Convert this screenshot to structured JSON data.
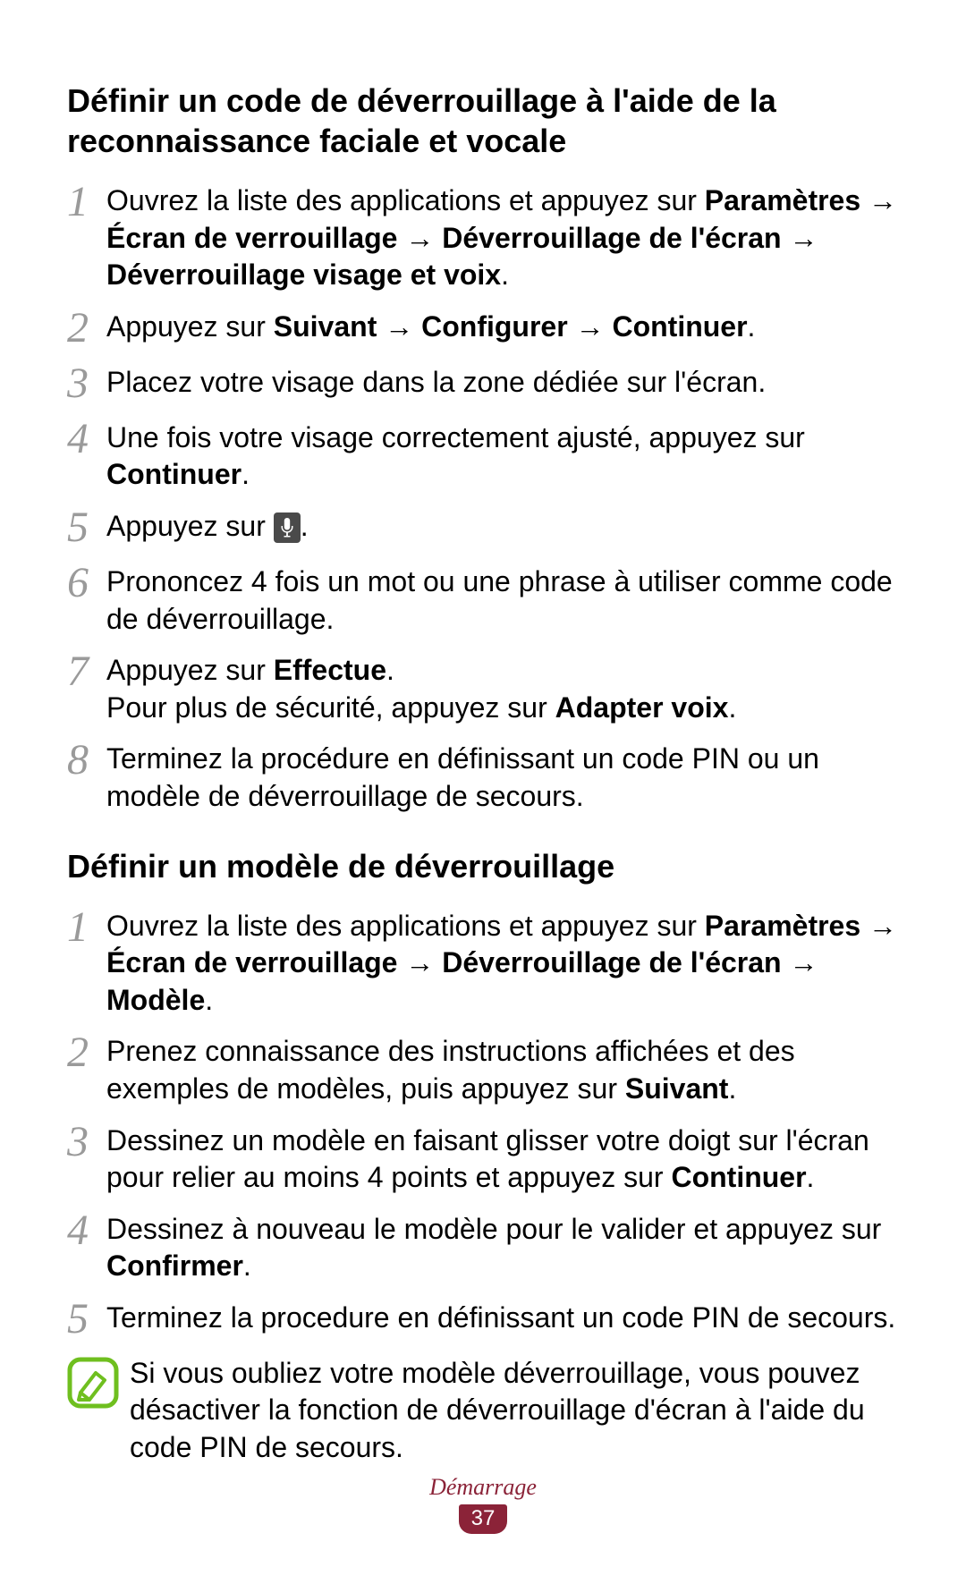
{
  "section1": {
    "heading": "Définir un code de déverrouillage à l'aide de la reconnaissance faciale et vocale",
    "steps": {
      "s1": {
        "pre": "Ouvrez la liste des applications et appuyez sur ",
        "b1": "Paramètres",
        "arr1": " → ",
        "b2": "Écran de verrouillage",
        "arr2": " → ",
        "b3": "Déverrouillage de l'écran",
        "arr3": " → ",
        "b4": "Déverrouillage visage et voix",
        "post": "."
      },
      "s2": {
        "pre": "Appuyez sur ",
        "b1": "Suivant",
        "arr1": " → ",
        "b2": "Configurer",
        "arr2": " → ",
        "b3": "Continuer",
        "post": "."
      },
      "s3": "Placez votre visage dans la zone dédiée sur l'écran.",
      "s4": {
        "pre": "Une fois votre visage correctement ajusté, appuyez sur ",
        "b1": "Continuer",
        "post": "."
      },
      "s5": {
        "pre": "Appuyez sur ",
        "post": "."
      },
      "s6": "Prononcez 4 fois un mot ou une phrase à utiliser comme code de déverrouillage.",
      "s7": {
        "line1pre": "Appuyez sur ",
        "line1b": "Effectue",
        "line1post": ".",
        "line2pre": "Pour plus de sécurité, appuyez sur ",
        "line2b": "Adapter voix",
        "line2post": "."
      },
      "s8": "Terminez la procédure en définissant un code PIN ou un modèle de déverrouillage de secours."
    }
  },
  "section2": {
    "heading": "Définir un modèle de déverrouillage",
    "steps": {
      "s1": {
        "pre": "Ouvrez la liste des applications et appuyez sur ",
        "b1": "Paramètres",
        "arr1": " → ",
        "b2": "Écran de verrouillage",
        "arr2": " → ",
        "b3": "Déverrouillage de l'écran",
        "arr3": " → ",
        "b4": "Modèle",
        "post": "."
      },
      "s2": {
        "pre": "Prenez connaissance des instructions affichées et des exemples de modèles, puis appuyez sur ",
        "b1": "Suivant",
        "post": "."
      },
      "s3": {
        "pre": "Dessinez un modèle en faisant glisser votre doigt sur l'écran pour relier au moins 4 points et appuyez sur ",
        "b1": "Continuer",
        "post": "."
      },
      "s4": {
        "pre": "Dessinez à nouveau le modèle pour le valider et appuyez sur ",
        "b1": "Confirmer",
        "post": "."
      },
      "s5": "Terminez la procedure en définissant un code PIN de secours."
    },
    "note": "Si vous oubliez votre modèle déverrouillage, vous pouvez désactiver la fonction de déverrouillage d'écran à l'aide du code PIN de secours."
  },
  "nums": {
    "n1": "1",
    "n2": "2",
    "n3": "3",
    "n4": "4",
    "n5": "5",
    "n6": "6",
    "n7": "7",
    "n8": "8"
  },
  "footer": {
    "category": "Démarrage",
    "page": "37"
  }
}
